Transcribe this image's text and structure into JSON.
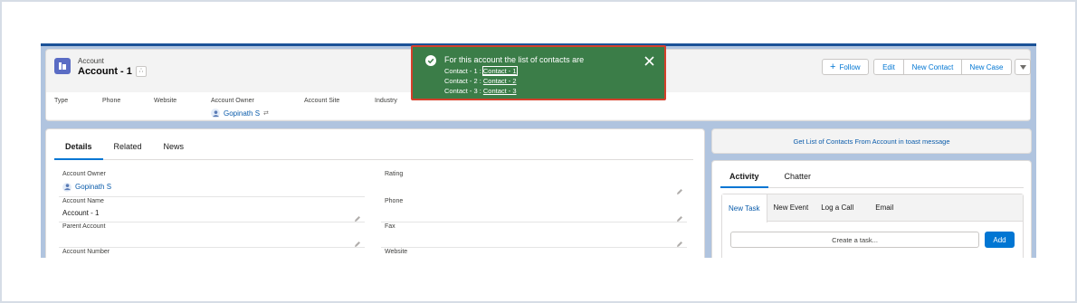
{
  "header": {
    "object_type": "Account",
    "record_name": "Account - 1",
    "buttons": {
      "follow": "Follow",
      "edit": "Edit",
      "new_contact": "New Contact",
      "new_case": "New Case"
    },
    "fields": {
      "type": "Type",
      "phone": "Phone",
      "website": "Website",
      "account_owner": "Account Owner",
      "account_site": "Account Site",
      "industry": "Industry",
      "owner_value": "Gopinath S"
    }
  },
  "toast": {
    "title": "For this account the list of contacts are",
    "lines": [
      {
        "prefix": "Contact - 1 :",
        "link": "Contact - 1"
      },
      {
        "prefix": "Contact - 2 :",
        "link": "Contact - 2"
      },
      {
        "prefix": "Contact - 3 :",
        "link": "Contact - 3"
      }
    ],
    "color": "#3b7d48"
  },
  "details": {
    "tabs": [
      "Details",
      "Related",
      "News"
    ],
    "fields": [
      {
        "label": "Account Owner",
        "value": "Gopinath S"
      },
      {
        "label": "Rating",
        "value": ""
      },
      {
        "label": "Account Name",
        "value": "Account - 1"
      },
      {
        "label": "Phone",
        "value": ""
      },
      {
        "label": "Parent Account",
        "value": ""
      },
      {
        "label": "Fax",
        "value": ""
      },
      {
        "label": "Account Number",
        "value": ""
      },
      {
        "label": "Website",
        "value": ""
      }
    ]
  },
  "action_bar": {
    "label": "Get List of Contacts From Account in toast message"
  },
  "activity": {
    "tabs": [
      "Activity",
      "Chatter"
    ],
    "publisher_tabs": [
      "New Task",
      "New Event",
      "Log a Call",
      "Email"
    ],
    "task_placeholder": "Create a task...",
    "add_label": "Add"
  },
  "colors": {
    "brand": "#0176d3",
    "link": "#0b5cab",
    "toast_border": "#d5402b"
  }
}
